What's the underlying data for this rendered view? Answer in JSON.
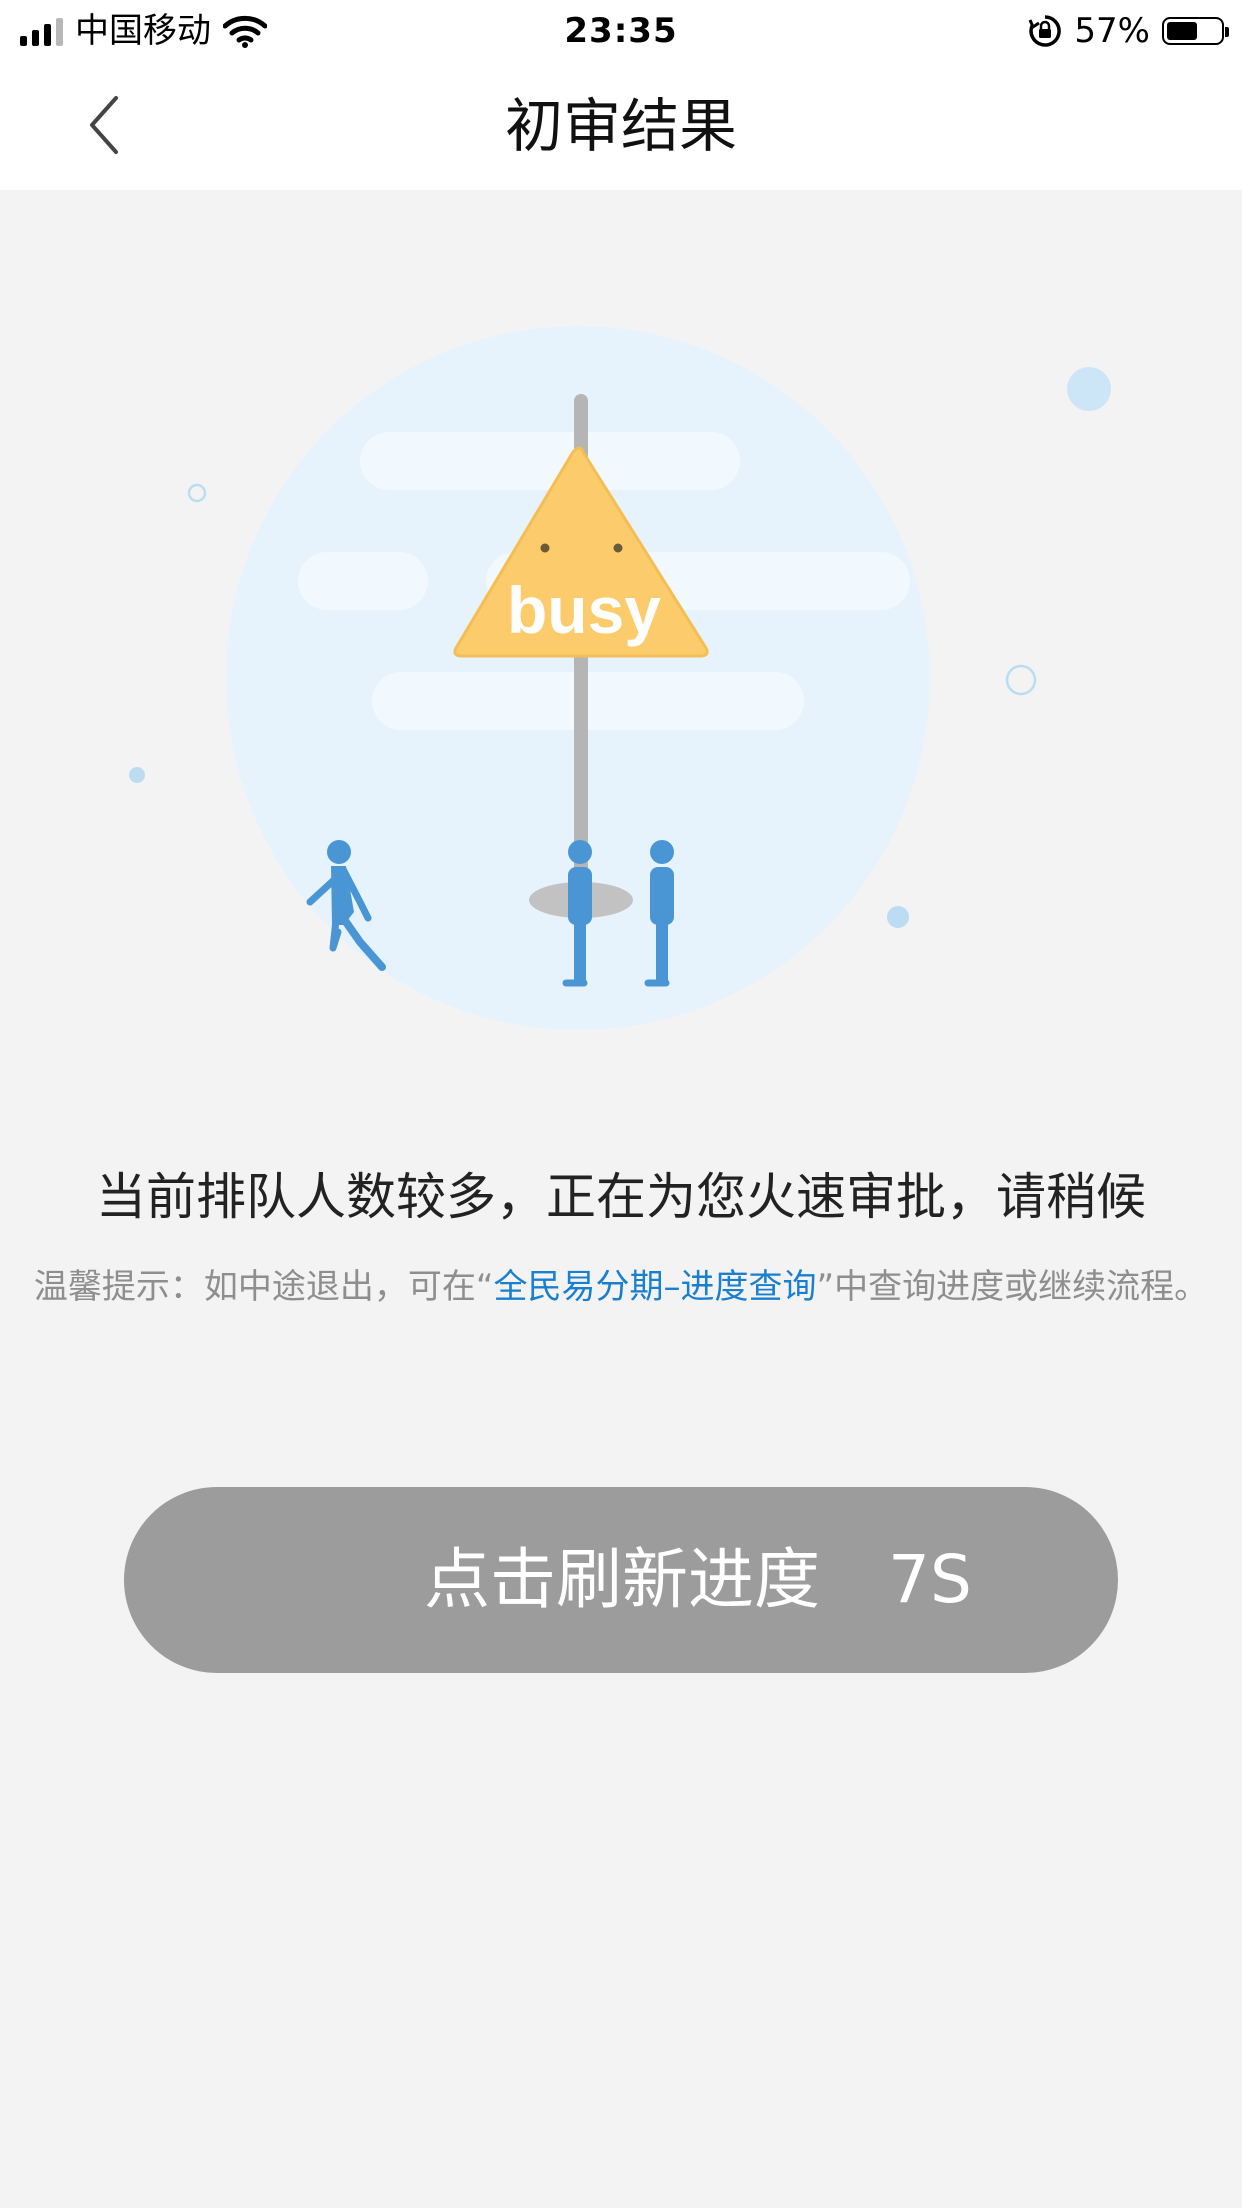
{
  "status_bar": {
    "carrier": "中国移动",
    "time": "23:35",
    "battery_percent": "57%",
    "battery_level": 0.57,
    "icons": [
      "signal-icon",
      "wifi-icon",
      "rotation-lock-icon",
      "battery-icon"
    ]
  },
  "nav": {
    "title": "初审结果",
    "back_icon": "chevron-left-icon"
  },
  "illustration": {
    "sign_text": "busy",
    "colors": {
      "circle": "#e6f3fc",
      "sign": "#fccc6c",
      "figure": "#4a96d4",
      "pole": "#b5b5b5"
    }
  },
  "message": {
    "main": "当前排队人数较多，正在为您火速审批，请稍候",
    "tip_prefix": "温馨提示：如中途退出，可在“",
    "tip_link": "全民易分期–进度查询",
    "tip_suffix": "”中查询进度或继续流程。"
  },
  "refresh_button": {
    "label": "点击刷新进度",
    "countdown": "7S",
    "color": "#9c9c9c"
  },
  "colors": {
    "background": "#f3f3f3",
    "link": "#1a7fcf"
  }
}
